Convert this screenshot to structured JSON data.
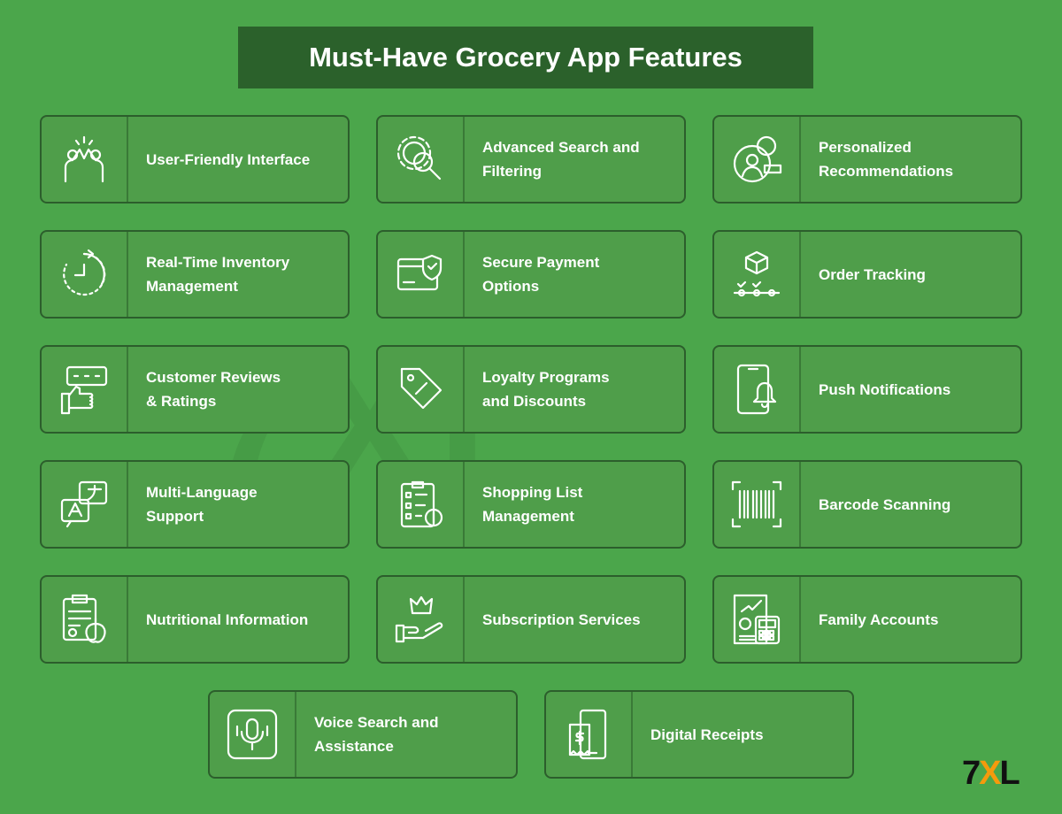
{
  "title": "Must-Have Grocery App Features",
  "watermark": "7XL",
  "brand": {
    "seven": "7",
    "x": "X",
    "l": "L",
    "accent": "#f59a0c"
  },
  "colors": {
    "background": "#4ba64b",
    "card": "#4f9e4a",
    "title_bar": "#2b612b"
  },
  "features": [
    {
      "label": "User-Friendly Interface",
      "icon": "high-five-icon"
    },
    {
      "label": "Advanced Search and\nFiltering",
      "icon": "gear-search-icon"
    },
    {
      "label": "Personalized\nRecommendations",
      "icon": "user-like-icon"
    },
    {
      "label": "Real-Time Inventory\nManagement",
      "icon": "clock-icon"
    },
    {
      "label": "Secure Payment\nOptions",
      "icon": "card-shield-icon"
    },
    {
      "label": "Order Tracking",
      "icon": "package-track-icon"
    },
    {
      "label": "Customer Reviews\n& Ratings",
      "icon": "thumbs-stars-icon"
    },
    {
      "label": "Loyalty Programs\nand Discounts",
      "icon": "sale-tag-icon"
    },
    {
      "label": "Push Notifications",
      "icon": "phone-bell-icon"
    },
    {
      "label": "Multi-Language\nSupport",
      "icon": "translate-icon"
    },
    {
      "label": "Shopping List\nManagement",
      "icon": "checklist-icon"
    },
    {
      "label": "Barcode Scanning",
      "icon": "barcode-icon"
    },
    {
      "label": "Nutritional Information",
      "icon": "clipboard-apple-icon"
    },
    {
      "label": "Subscription Services",
      "icon": "crown-hand-icon"
    },
    {
      "label": "Family Accounts",
      "icon": "accounts-calculator-icon"
    },
    {
      "label": "Voice Search and\nAssistance",
      "icon": "microphone-icon"
    },
    {
      "label": "Digital Receipts",
      "icon": "phone-receipt-icon"
    }
  ]
}
